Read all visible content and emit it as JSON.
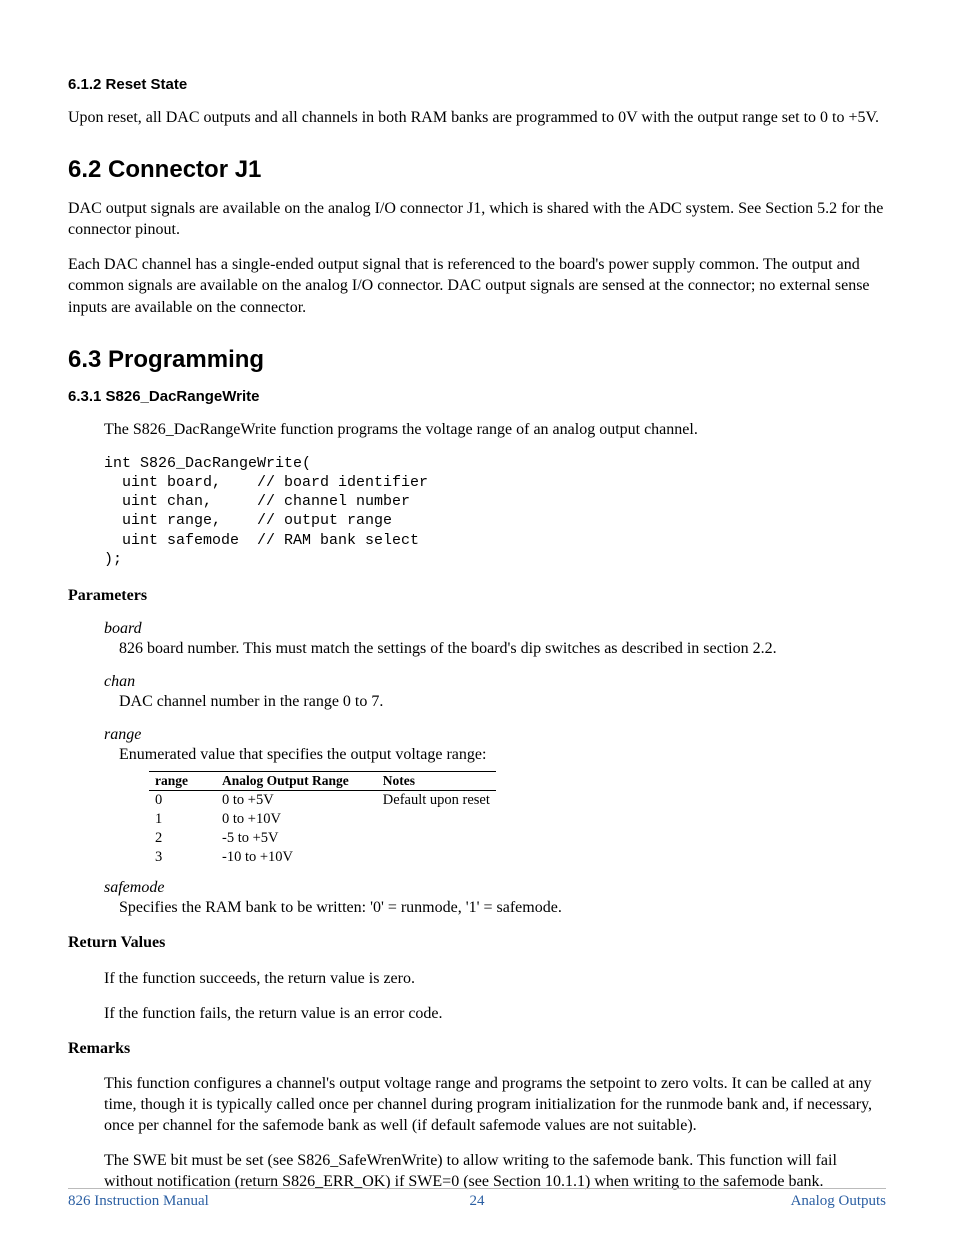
{
  "sec612": {
    "heading": "6.1.2   Reset State",
    "body": "Upon reset, all DAC outputs and all channels in both RAM banks are programmed to 0V with the output range set to 0 to +5V."
  },
  "sec62": {
    "heading": "6.2  Connector J1",
    "p1": "DAC output signals are available on the analog I/O connector J1, which is shared with the ADC system. See Section 5.2 for the connector pinout.",
    "p2": "Each DAC channel has a single-ended output signal that is referenced to the board's power supply common. The output and common signals are available on the analog I/O connector. DAC output signals are sensed at the connector; no external sense inputs are available on the connector."
  },
  "sec63": {
    "heading": "6.3  Programming"
  },
  "sec631": {
    "heading": "6.3.1   S826_DacRangeWrite",
    "intro": "The S826_DacRangeWrite function programs the voltage range of an analog output channel.",
    "code": "int S826_DacRangeWrite(\n  uint board,    // board identifier\n  uint chan,     // channel number\n  uint range,    // output range\n  uint safemode  // RAM bank select\n);",
    "params_heading": "Parameters",
    "params": {
      "board": {
        "name": "board",
        "desc": "826 board number. This must match the settings of the board's dip switches as described in section 2.2."
      },
      "chan": {
        "name": "chan",
        "desc": "DAC channel number in the range 0 to 7."
      },
      "range": {
        "name": "range",
        "desc": "Enumerated value that specifies the output voltage range:"
      },
      "safemode": {
        "name": "safemode",
        "desc": "Specifies the RAM bank to be written: '0' = runmode, '1' = safemode."
      }
    },
    "table": {
      "headers": [
        "range",
        "Analog Output Range",
        "Notes"
      ],
      "rows": [
        [
          "0",
          "0 to +5V",
          "Default upon reset"
        ],
        [
          "1",
          "0 to +10V",
          ""
        ],
        [
          "2",
          "-5 to +5V",
          ""
        ],
        [
          "3",
          "-10 to +10V",
          ""
        ]
      ]
    },
    "retval_heading": "Return Values",
    "retval_p1": "If the function succeeds, the return value is zero.",
    "retval_p2": "If the function fails, the return value is an error code.",
    "remarks_heading": "Remarks",
    "remarks_p1": "This function configures a channel's output voltage range and programs the setpoint to zero volts. It can be called at any time, though it is typically called once per channel during program initialization for the runmode bank and, if necessary, once per channel for the safemode bank as well (if default safemode values are not suitable).",
    "remarks_p2": "The SWE bit must be set (see S826_SafeWrenWrite) to allow writing to the safemode bank. This function will fail without notification (return S826_ERR_OK) if SWE=0 (see Section 10.1.1) when writing to the safemode bank."
  },
  "footer": {
    "left": "826 Instruction Manual",
    "center": "24",
    "right": "Analog Outputs"
  }
}
